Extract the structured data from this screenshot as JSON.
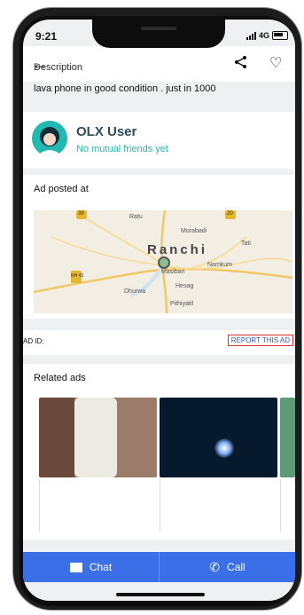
{
  "status": {
    "time": "9:21",
    "network": "4G"
  },
  "description": {
    "title": "Description",
    "text": "lava phone in good condition . just in 1000"
  },
  "user": {
    "name": "OLX User",
    "subtitle": "No mutual friends yet"
  },
  "location": {
    "heading": "Ad posted at",
    "map_labels": [
      "Ratu",
      "Morabadi",
      "Tati",
      "Ranchi",
      "Namkum",
      "Masibari",
      "Hesag",
      "Dhurwa",
      "Pithiyatil"
    ],
    "road_badges": [
      "39",
      "20",
      "NH 43"
    ]
  },
  "ad": {
    "id_label": "AD ID:",
    "report_label": "REPORT THIS AD"
  },
  "related": {
    "title": "Related ads"
  },
  "actions": {
    "chat_label": "Chat",
    "call_label": "Call"
  },
  "icons": {
    "back": "back-arrow-icon",
    "share": "share-icon",
    "favorite": "heart-icon",
    "chat": "chat-icon",
    "call": "phone-icon"
  },
  "colors": {
    "accent": "#3a6fe8",
    "teal": "#23b8b2",
    "report_border": "#dd3333"
  }
}
